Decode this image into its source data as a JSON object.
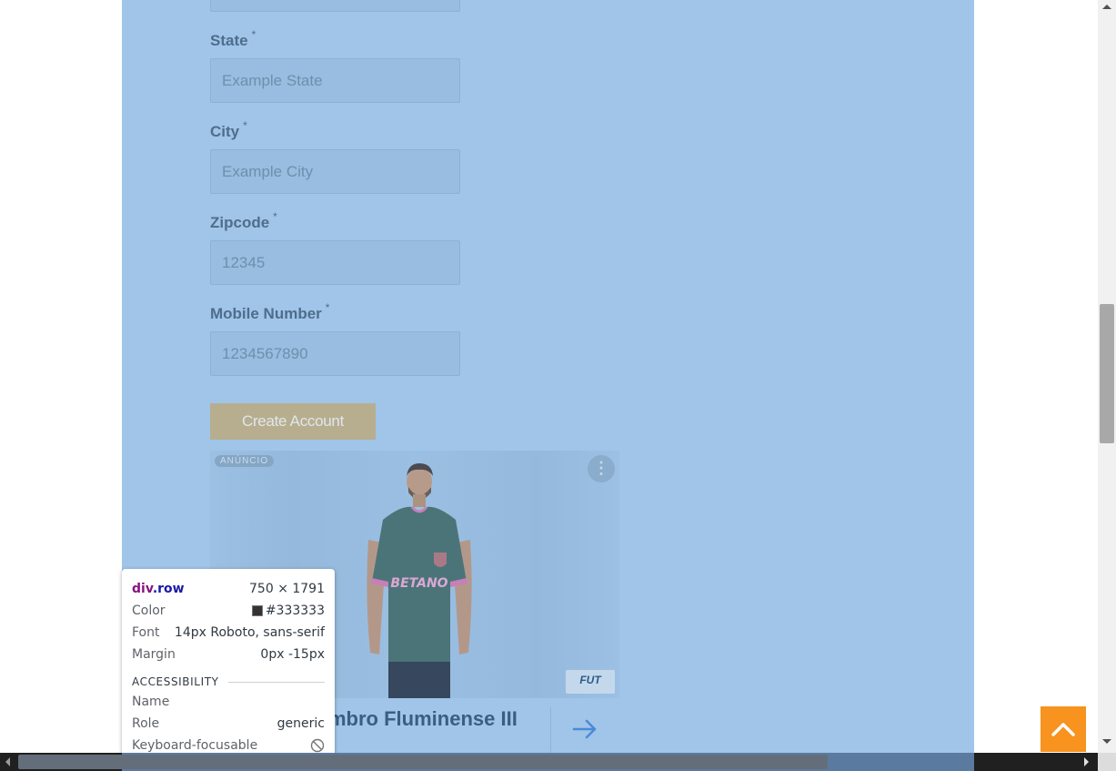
{
  "form": {
    "fields": [
      {
        "label": "State",
        "required_mark": "*",
        "placeholder": "Example State"
      },
      {
        "label": "City",
        "required_mark": "*",
        "placeholder": "Example City"
      },
      {
        "label": "Zipcode",
        "required_mark": "*",
        "placeholder": "12345"
      },
      {
        "label": "Mobile Number",
        "required_mark": "*",
        "placeholder": "1234567890"
      }
    ],
    "submit_label": "Create Account"
  },
  "ad": {
    "badge": "ANÚNCIO",
    "menu_glyph": "⋮",
    "logo_text": "FUT",
    "jersey_text": "BETANO",
    "title": "mbro Fluminense III",
    "arrow_icon": "arrow-right-icon"
  },
  "inspector": {
    "tag": "div",
    "class_name": ".row",
    "dimensions": "750 × 1791",
    "color_label": "Color",
    "color_value": "#333333",
    "font_label": "Font",
    "font_value": "14px Roboto, sans-serif",
    "margin_label": "Margin",
    "margin_value": "0px -15px",
    "section_title": "ACCESSIBILITY",
    "name_label": "Name",
    "name_value": "",
    "role_label": "Role",
    "role_value": "generic",
    "focusable_label": "Keyboard-focusable",
    "focusable_icon": "not-allowed-icon"
  },
  "colors": {
    "highlight": "#a0c5e8",
    "scroll_top_button": "#f7931e",
    "submit_button": "#b7ae8f"
  },
  "scroll_top": {
    "icon": "chevron-up-icon"
  }
}
